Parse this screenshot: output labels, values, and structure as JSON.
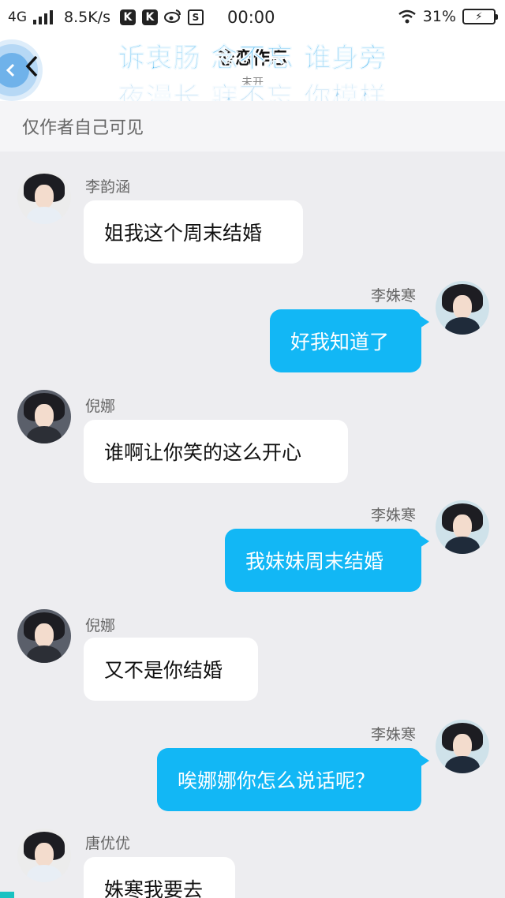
{
  "status_bar": {
    "network": "4G",
    "speed": "8.5K/s",
    "app_icon_1": "K",
    "app_icon_2": "K",
    "weibo_icon": "weibo-icon",
    "s_icon": "S",
    "time": "00:00",
    "battery": "31%"
  },
  "header": {
    "title": "恋恋作忘",
    "subtitle": "未开",
    "lyric_line_1": "诉衷肠 念不忘 谁身旁",
    "lyric_line_2": "夜漫长 寐不忘 你模样",
    "badge_icon": "float-ball-icon"
  },
  "notice": "仅作者自己可见",
  "messages": [
    {
      "side": "left",
      "name": "李韵涵",
      "text": "姐我这个周末结婚"
    },
    {
      "side": "right",
      "name": "李姝寒",
      "text": "好我知道了"
    },
    {
      "side": "left",
      "name": "倪娜",
      "text": "谁啊让你笑的这么开心"
    },
    {
      "side": "right",
      "name": "李姝寒",
      "text": "我妹妹周末结婚"
    },
    {
      "side": "left",
      "name": "倪娜",
      "text": "又不是你结婚"
    },
    {
      "side": "right",
      "name": "李姝寒",
      "text": "唉娜娜你怎么说话呢？"
    },
    {
      "side": "left",
      "name": "唐优优",
      "text": "姝寒我要去"
    }
  ],
  "colors": {
    "accent": "#12b7f5",
    "background": "#ededf0"
  }
}
